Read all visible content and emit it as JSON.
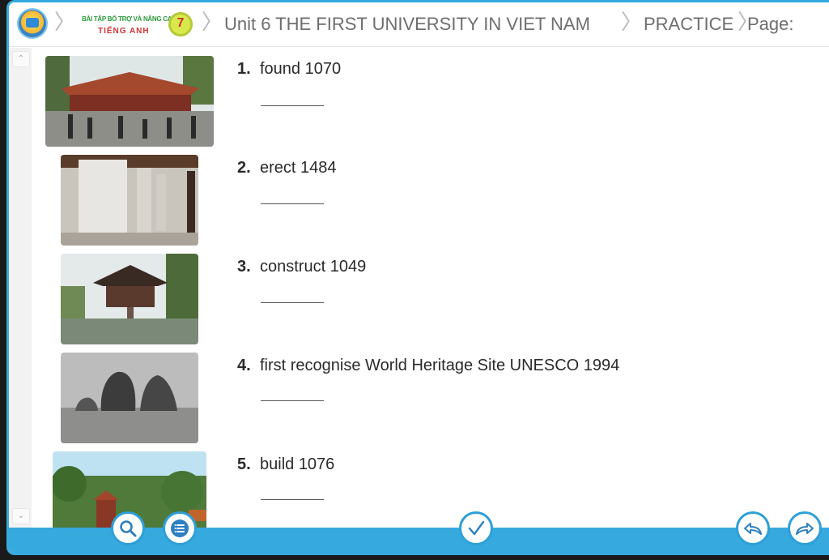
{
  "header": {
    "logo_top": "BÀI TẬP BỔ TRỢ VÀ NÂNG CAO",
    "logo_bottom": "TIẾNG ANH",
    "grade": "7",
    "breadcrumb": [
      "Unit 6 THE FIRST UNIVERSITY IN VIET NAM",
      "PRACTICE",
      "Page:"
    ]
  },
  "questions": [
    {
      "num": "1.",
      "text": "found 1070",
      "answer": ""
    },
    {
      "num": "2.",
      "text": "erect 1484",
      "answer": ""
    },
    {
      "num": "3.",
      "text": "construct 1049",
      "answer": ""
    },
    {
      "num": "4.",
      "text": "first recognise World Heritage Site UNESCO 1994",
      "answer": ""
    },
    {
      "num": "5.",
      "text": "build 1076",
      "answer": ""
    }
  ],
  "toolbar": {
    "search": "search-icon",
    "menu": "list-icon",
    "check": "check-icon",
    "back": "back-icon",
    "forward": "forward-icon"
  },
  "colors": {
    "accent": "#36a9de",
    "text": "#2a2a2a"
  }
}
